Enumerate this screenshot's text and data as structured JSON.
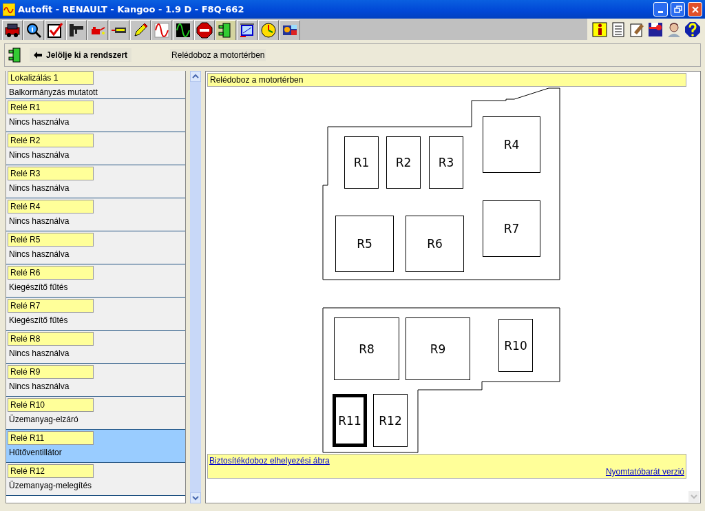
{
  "window": {
    "title": "Autofit - RENAULT - Kangoo - 1.9 D - F8Q-662"
  },
  "toolbar": {
    "tools": [
      {
        "selected": false
      },
      {
        "selected": false
      },
      {
        "selected": false
      },
      {
        "selected": false
      },
      {
        "selected": false
      },
      {
        "selected": false
      },
      {
        "selected": false
      },
      {
        "selected": false
      },
      {
        "selected": false
      },
      {
        "selected": false
      },
      {
        "selected": true
      },
      {
        "selected": false
      },
      {
        "selected": false
      },
      {
        "selected": false
      }
    ]
  },
  "breadcrumb": {
    "back": "Jelölje ki a rendszert",
    "current": "Relédoboz a motortérben"
  },
  "list": [
    {
      "label": "Lokalizálás 1",
      "value": "Balkormányzás mutatott",
      "selected": false
    },
    {
      "label": "Relé R1",
      "value": "Nincs használva",
      "selected": false
    },
    {
      "label": "Relé R2",
      "value": "Nincs használva",
      "selected": false
    },
    {
      "label": "Relé R3",
      "value": "Nincs használva",
      "selected": false
    },
    {
      "label": "Relé R4",
      "value": "Nincs használva",
      "selected": false
    },
    {
      "label": "Relé R5",
      "value": "Nincs használva",
      "selected": false
    },
    {
      "label": "Relé R6",
      "value": "Kiegészítő fűtés",
      "selected": false
    },
    {
      "label": "Relé R7",
      "value": "Kiegészítő fűtés",
      "selected": false
    },
    {
      "label": "Relé R8",
      "value": "Nincs használva",
      "selected": false
    },
    {
      "label": "Relé R9",
      "value": "Nincs használva",
      "selected": false
    },
    {
      "label": "Relé R10",
      "value": "Üzemanyag-elzáró",
      "selected": false
    },
    {
      "label": "Relé R11",
      "value": "Hűtőventillátor",
      "selected": true
    },
    {
      "label": "Relé R12",
      "value": "Üzemanyag-melegítés",
      "selected": false
    }
  ],
  "panel": {
    "title": "Relédoboz a motortérben",
    "relays": [
      {
        "label": "R1",
        "selected": false
      },
      {
        "label": "R2",
        "selected": false
      },
      {
        "label": "R3",
        "selected": false
      },
      {
        "label": "R4",
        "selected": false
      },
      {
        "label": "R5",
        "selected": false
      },
      {
        "label": "R6",
        "selected": false
      },
      {
        "label": "R7",
        "selected": false
      },
      {
        "label": "R8",
        "selected": false
      },
      {
        "label": "R9",
        "selected": false
      },
      {
        "label": "R10",
        "selected": false
      },
      {
        "label": "R11",
        "selected": true
      },
      {
        "label": "R12",
        "selected": false
      }
    ],
    "link": "Biztosítékdoboz elhelyezési ábra",
    "print_link": "Nyomtatóbarát verzió"
  }
}
